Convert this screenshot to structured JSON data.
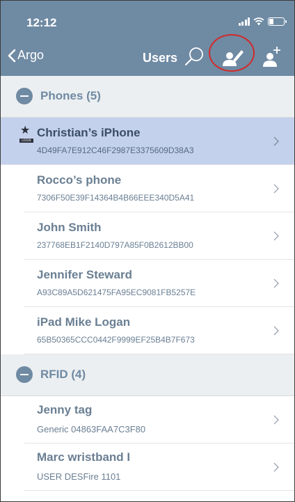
{
  "status_bar": {
    "time": "12:12"
  },
  "nav": {
    "back_label": "Argo",
    "title": "Users",
    "icons": [
      "chevron-left-icon",
      "search-icon",
      "user-edit-icon",
      "user-add-icon"
    ]
  },
  "sections": [
    {
      "title": "Phones (5)",
      "items": [
        {
          "name": "Christian’s iPhone",
          "sub": "4D49FA7E912C46F2987E3375609D38A3",
          "selected": true,
          "starred": true,
          "badge": "LOGIN"
        },
        {
          "name": "Rocco’s phone",
          "sub": "7306F50E39F14364B4B66EEE340D5A41"
        },
        {
          "name": "John Smith",
          "sub": "237768EB1F2140D797A85F0B2612BB00"
        },
        {
          "name": "Jennifer Steward",
          "sub": "A93C89A5D621475FA95EC9081FB5257E"
        },
        {
          "name": "iPad Mike Logan",
          "sub": "65B50365CCC0442F9999EF25B4B7F673"
        }
      ]
    },
    {
      "title": "RFID (4)",
      "items": [
        {
          "name": "Jenny tag",
          "sub": "Generic 04863FAA7C3F80"
        },
        {
          "name": "Marc wristband I",
          "sub": "USER DESFire 1101"
        }
      ]
    }
  ],
  "colors": {
    "header_bg": "#6f8aa3",
    "selected_row_bg": "#c4d1ec",
    "section_bg": "#eceff1",
    "highlight_ring": "#d12b2b"
  }
}
